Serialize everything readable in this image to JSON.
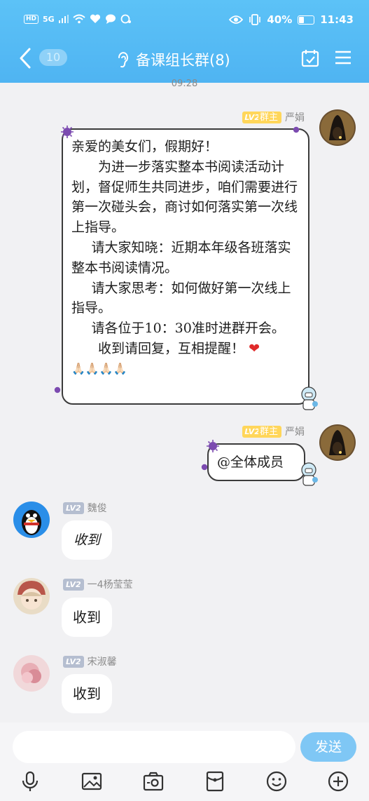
{
  "status": {
    "signal": "5G",
    "battery": "40%",
    "time": "11:43",
    "hd": "HD"
  },
  "header": {
    "back_count": "10",
    "title": "备课组长群(8)"
  },
  "chat": {
    "timestamp": "09:28",
    "messages": [
      {
        "sender": "严娟",
        "level": "LV2",
        "role": "群主",
        "lines": [
          "亲爱的美女们，假期好！",
          "为进一步落实整本书阅读活动计划，督促师生共同进步，咱们需要进行第一次碰头会，商讨如何落实第一次线上指导。",
          "请大家知晓：近期本年级各班落实整本书阅读情况。",
          "请大家思考：如何做好第一次线上指导。",
          "请各位于10：30准时进群开会。",
          "收到请回复，互相提醒！",
          "🙏🏻🙏🏻🙏🏻🙏🏻"
        ]
      },
      {
        "sender": "严娟",
        "level": "LV2",
        "role": "群主",
        "text": "@全体成员"
      },
      {
        "sender": "魏俊",
        "level": "LV2",
        "text": "收到"
      },
      {
        "sender": "一4杨莹莹",
        "level": "LV2",
        "text": "收到"
      },
      {
        "sender": "宋淑馨",
        "level": "LV2",
        "text": "收到"
      }
    ]
  },
  "input": {
    "placeholder": "",
    "send_label": "发送"
  },
  "toolbar": [
    "mic-icon",
    "image-icon",
    "camera-icon",
    "red-packet-icon",
    "emoji-icon",
    "plus-icon"
  ],
  "colors": {
    "accent": "#4fb4f2",
    "send": "#7fc7f5",
    "owner_badge": "#ffd65a"
  }
}
